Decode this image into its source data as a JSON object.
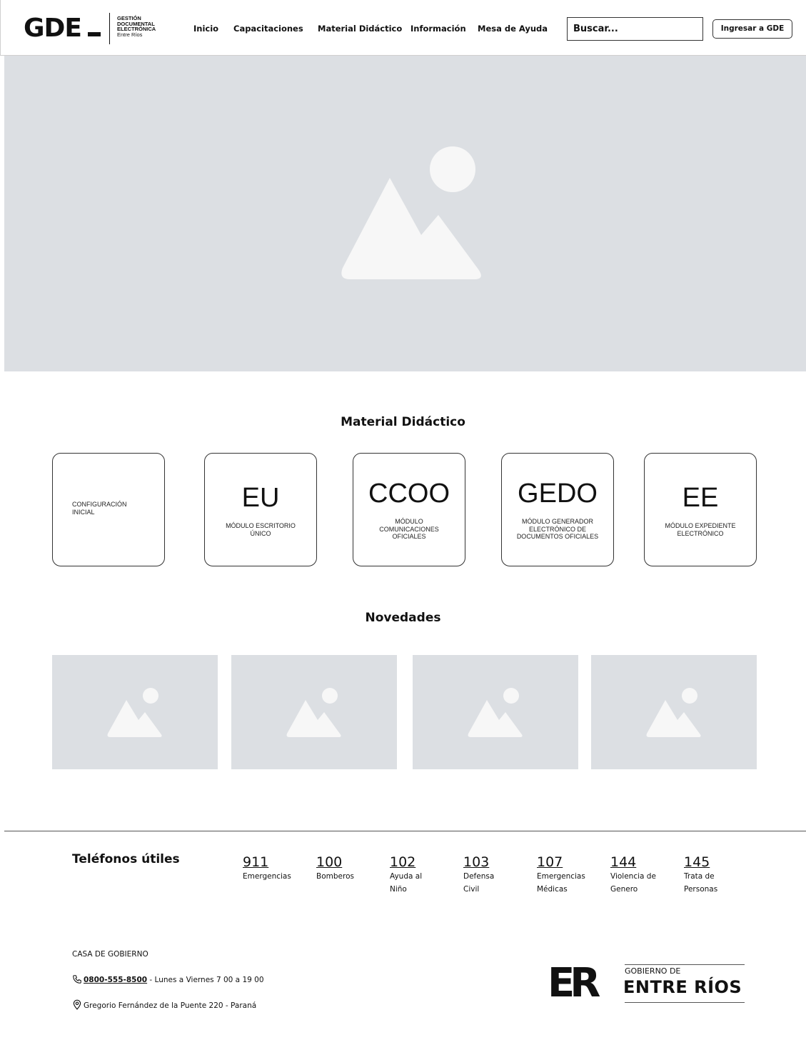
{
  "header": {
    "logo": {
      "mark": "GDE",
      "line1": "GESTIÓN",
      "line2": "DOCUMENTAL",
      "line3": "ELECTRÓNICA",
      "line4": "Entre Ríos"
    },
    "nav": [
      "Inicio",
      "Capacitaciones",
      "Material Didáctico",
      "Información",
      "Mesa de Ayuda"
    ],
    "search_placeholder": "Buscar...",
    "login_label": "Ingresar a GDE"
  },
  "hero": {
    "icon": "image-placeholder-icon"
  },
  "material": {
    "title": "Material Didáctico",
    "cards": [
      {
        "abbr": "",
        "desc": "CONFIGURACIÓN INICIAL"
      },
      {
        "abbr": "EU",
        "desc": "MÓDULO ESCRITORIO ÚNICO"
      },
      {
        "abbr": "CCOO",
        "desc": "MÓDULO COMUNICACIONES OFICIALES"
      },
      {
        "abbr": "GEDO",
        "desc": "MÓDULO GENERADOR ELECTRÓNICO DE DOCUMENTOS OFICIALES"
      },
      {
        "abbr": "EE",
        "desc": "MÓDULO EXPEDIENTE ELECTRÓNICO"
      }
    ]
  },
  "novedades": {
    "title": "Novedades",
    "count_icon": "image-placeholder-icon"
  },
  "footer": {
    "phones_title": "Teléfonos útiles",
    "phones": [
      {
        "num": "911",
        "label": "Emergencias"
      },
      {
        "num": "100",
        "label": "Bomberos"
      },
      {
        "num": "102",
        "label": "Ayuda al Niño"
      },
      {
        "num": "103",
        "label": "Defensa Civil"
      },
      {
        "num": "107",
        "label": "Emergencias Médicas"
      },
      {
        "num": "144",
        "label": "Violencia de Genero"
      },
      {
        "num": "145",
        "label": "Trata de Personas"
      }
    ],
    "casa": "CASA DE GOBIERNO",
    "phone_link": "0800-555-8500",
    "phone_hours": " - Lunes a Viernes  7 00 a 19 00",
    "address": "Gregorio Fernández de la Puente 220 - Paraná",
    "gov_logo": {
      "mark": "ER",
      "small": "GOBIERNO DE",
      "big": "ENTRE RÍOS"
    }
  }
}
